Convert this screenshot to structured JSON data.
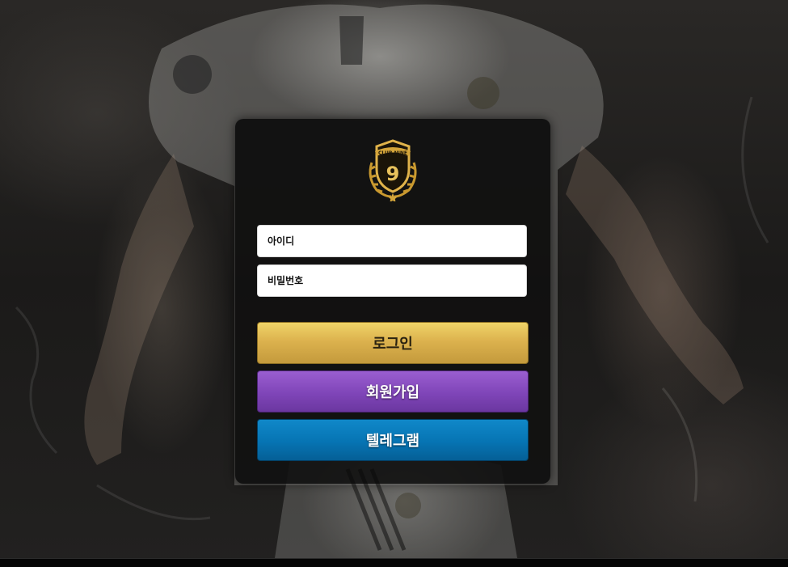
{
  "background": {
    "description_icon": "football-player-background"
  },
  "logo": {
    "icon": "club-nine-crest-icon",
    "text": "CLUB NINE",
    "number": "9",
    "color": "#d4a53a"
  },
  "form": {
    "id_placeholder": "아이디",
    "password_placeholder": "비밀번호"
  },
  "buttons": {
    "login_label": "로그인",
    "signup_label": "회원가입",
    "telegram_label": "텔레그램"
  },
  "colors": {
    "login": "#dcb24e",
    "signup": "#7f45b8",
    "telegram": "#0674b3"
  }
}
